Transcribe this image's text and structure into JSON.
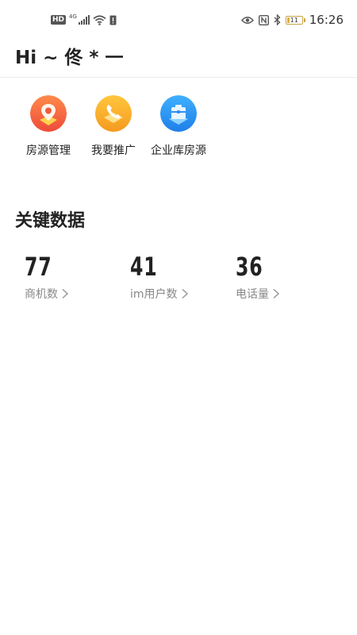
{
  "status_bar": {
    "left_badges": {
      "hd": "HD",
      "network": "4G"
    },
    "battery_level": "11",
    "time": "16:26",
    "icons": [
      "hd-icon",
      "signal-icon",
      "wifi-icon",
      "sim-alert-icon",
      "eye-icon",
      "nfc-icon",
      "bluetooth-icon",
      "battery-icon"
    ]
  },
  "header": {
    "greeting": "Hi ~ 佟 * 一"
  },
  "quick_actions": [
    {
      "label": "房源管理",
      "icon": "location-pin-icon",
      "color": "#f26b3a"
    },
    {
      "label": "我要推广",
      "icon": "phone-promo-icon",
      "color": "#f5a623"
    },
    {
      "label": "企业库房源",
      "icon": "enterprise-house-icon",
      "color": "#2f8ff5"
    }
  ],
  "key_data": {
    "title": "关键数据",
    "stats": [
      {
        "value": "77",
        "label": "商机数"
      },
      {
        "value": "41",
        "label": "im用户数"
      },
      {
        "value": "36",
        "label": "电话量"
      }
    ]
  }
}
